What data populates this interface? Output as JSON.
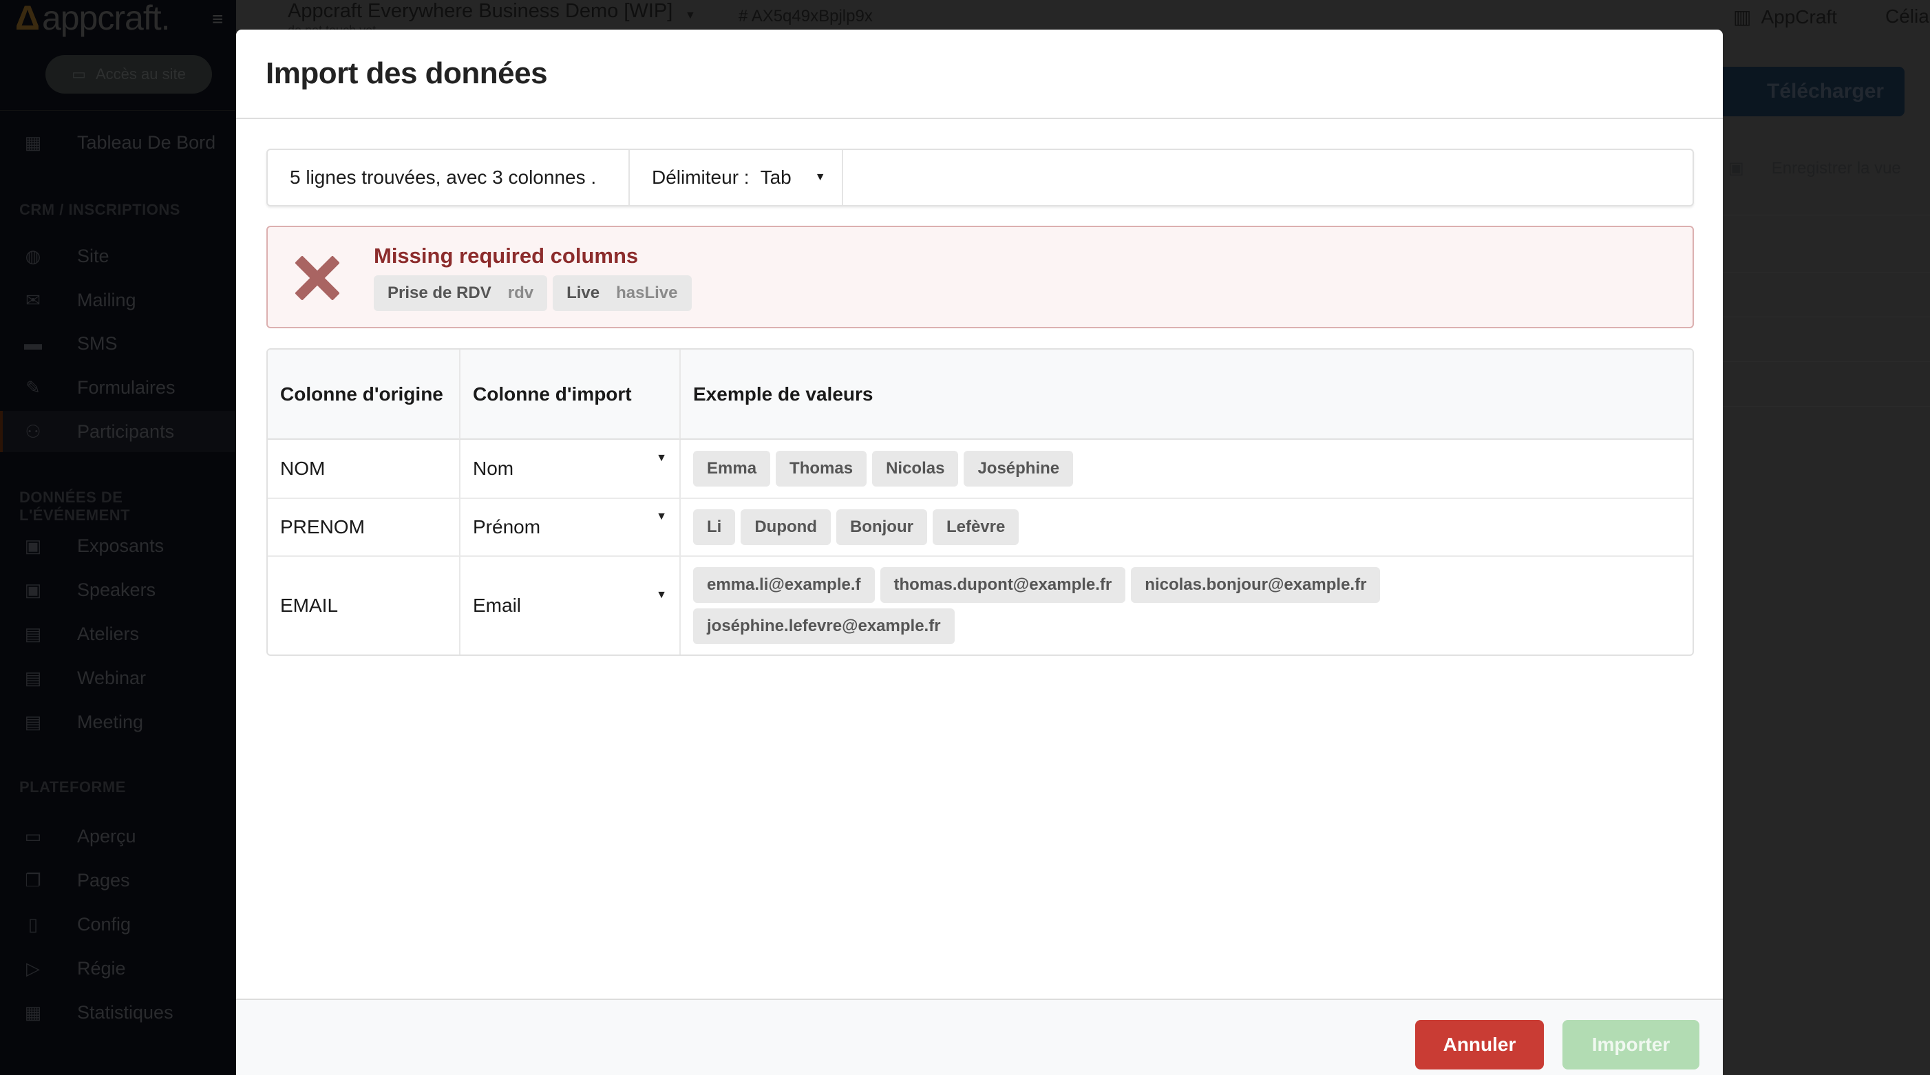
{
  "sidebar": {
    "logo": "appcraft.",
    "site_button": "Accès au site",
    "items_top": [
      {
        "icon": "dashboard-icon",
        "label": "Tableau De Bord"
      }
    ],
    "sections": [
      {
        "title": "CRM / INSCRIPTIONS",
        "items": [
          {
            "icon": "globe-icon",
            "label": "Site"
          },
          {
            "icon": "mail-icon",
            "label": "Mailing"
          },
          {
            "icon": "sms-icon",
            "label": "SMS"
          },
          {
            "icon": "pencil-icon",
            "label": "Formulaires"
          },
          {
            "icon": "people-icon",
            "label": "Participants",
            "active": true
          }
        ]
      },
      {
        "title": "DONNÉES DE L'ÉVÉNEMENT",
        "items": [
          {
            "icon": "contact-card-icon",
            "label": "Exposants"
          },
          {
            "icon": "contact-card-icon",
            "label": "Speakers"
          },
          {
            "icon": "calendar-icon",
            "label": "Ateliers"
          },
          {
            "icon": "calendar-icon",
            "label": "Webinar"
          },
          {
            "icon": "calendar-icon",
            "label": "Meeting"
          }
        ]
      },
      {
        "title": "PLATEFORME",
        "items": [
          {
            "icon": "laptop-icon",
            "label": "Aperçu"
          },
          {
            "icon": "pages-icon",
            "label": "Pages"
          },
          {
            "icon": "phone-settings-icon",
            "label": "Config"
          },
          {
            "icon": "video-settings-icon",
            "label": "Régie"
          },
          {
            "icon": "stats-icon",
            "label": "Statistiques"
          }
        ]
      }
    ]
  },
  "topbar": {
    "project_title": "Appcraft Everywhere Business Demo [WIP]",
    "project_subtitle": "do not touch yet",
    "project_id": "# AX5q49xBpjlp9x",
    "org": "AppCraft",
    "user": "Célia"
  },
  "background": {
    "download_label": "Télécharger",
    "save_view_label": "Enregistrer la vue"
  },
  "modal": {
    "title": "Import des données",
    "summary": "5 lignes trouvées, avec 3 colonnes .",
    "delimiter_label": "Délimiteur :",
    "delimiter_value": "Tab",
    "error": {
      "title": "Missing required columns",
      "missing": [
        {
          "label": "Prise de RDV",
          "key": "rdv"
        },
        {
          "label": "Live",
          "key": "hasLive"
        }
      ]
    },
    "table": {
      "headers": [
        "Colonne d'origine",
        "Colonne d'import",
        "Exemple de valeurs"
      ],
      "rows": [
        {
          "origin": "NOM",
          "target": "Nom",
          "examples": [
            "Emma",
            "Thomas",
            "Nicolas",
            "Joséphine"
          ]
        },
        {
          "origin": "PRENOM",
          "target": "Prénom",
          "examples": [
            "Li",
            "Dupond",
            "Bonjour",
            "Lefèvre"
          ]
        },
        {
          "origin": "EMAIL",
          "target": "Email",
          "examples": [
            "emma.li@example.f",
            "thomas.dupont@example.fr",
            "nicolas.bonjour@example.fr",
            "joséphine.lefevre@example.fr"
          ]
        }
      ]
    },
    "footer": {
      "cancel_label": "Annuler",
      "import_label": "Importer",
      "import_disabled": true
    }
  },
  "colors": {
    "error_text": "#8c2c2c",
    "error_bg": "#fcf4f4",
    "cancel": "#c93c34",
    "import_disabled": "#b2dcb3"
  }
}
